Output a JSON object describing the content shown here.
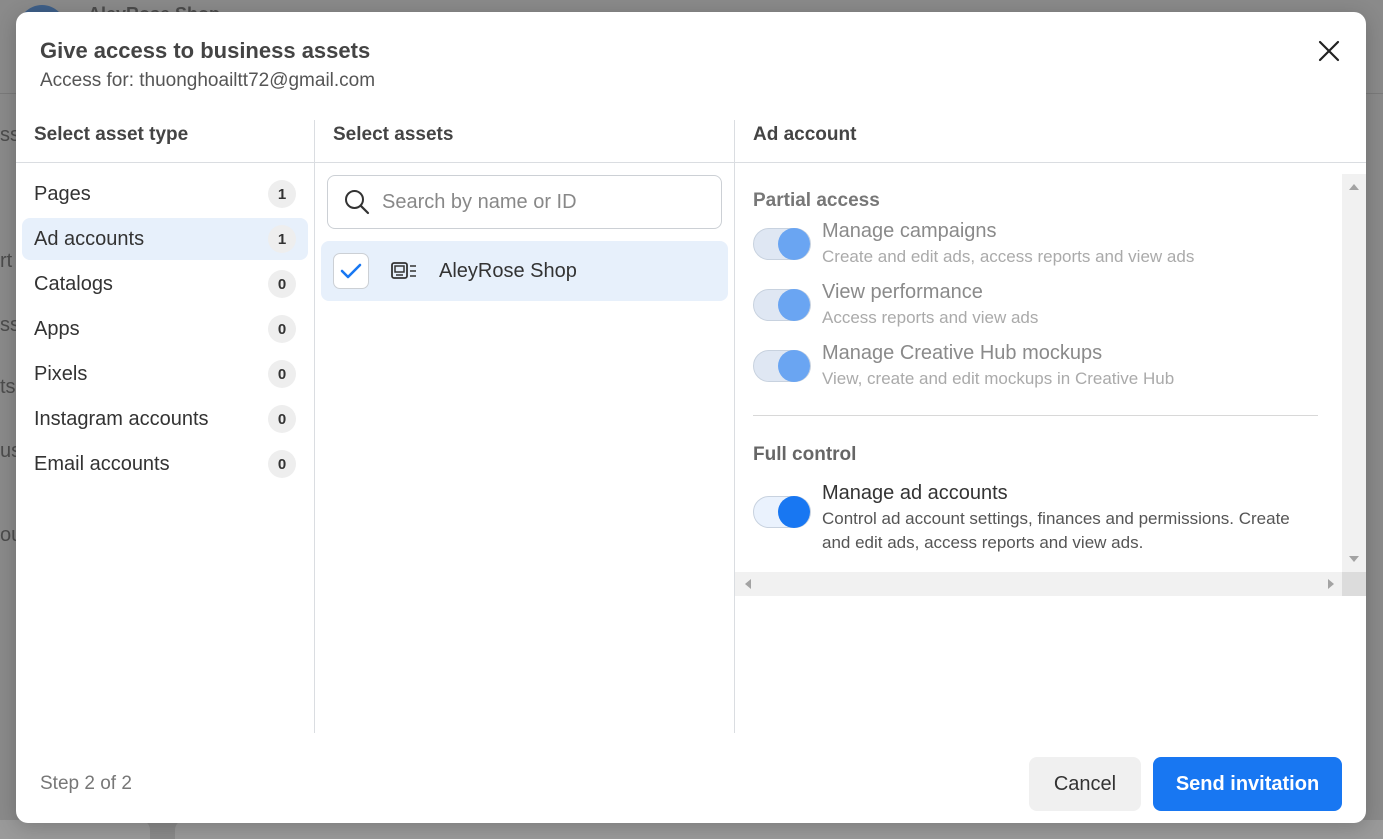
{
  "background": {
    "title_fragment": "AleyRose Shop",
    "left_fragments": [
      "ss",
      "rt",
      "ss",
      "ts",
      "us",
      "ou"
    ]
  },
  "dialog": {
    "title": "Give access to business assets",
    "subtitle": "Access for: thuonghoailtt72@gmail.com",
    "close_icon": "close-icon"
  },
  "asset_types": {
    "heading": "Select asset type",
    "items": [
      {
        "label": "Pages",
        "count": "1",
        "active": false
      },
      {
        "label": "Ad accounts",
        "count": "1",
        "active": true
      },
      {
        "label": "Catalogs",
        "count": "0",
        "active": false
      },
      {
        "label": "Apps",
        "count": "0",
        "active": false
      },
      {
        "label": "Pixels",
        "count": "0",
        "active": false
      },
      {
        "label": "Instagram accounts",
        "count": "0",
        "active": false
      },
      {
        "label": "Email accounts",
        "count": "0",
        "active": false
      }
    ]
  },
  "assets": {
    "heading": "Select assets",
    "search_placeholder": "Search by name or ID",
    "search_value": "",
    "items": [
      {
        "name": "AleyRose Shop",
        "checked": true,
        "icon": "ad-account-icon"
      }
    ]
  },
  "permissions": {
    "heading": "Ad account",
    "partial": {
      "title": "Partial access",
      "items": [
        {
          "name": "Manage campaigns",
          "desc": "Create and edit ads, access reports and view ads",
          "on": true
        },
        {
          "name": "View performance",
          "desc": "Access reports and view ads",
          "on": true
        },
        {
          "name": "Manage Creative Hub mockups",
          "desc": "View, create and edit mockups in Creative Hub",
          "on": true
        }
      ]
    },
    "full": {
      "title": "Full control",
      "items": [
        {
          "name": "Manage ad accounts",
          "desc": "Control ad account settings, finances and permissions. Create and edit ads, access reports and view ads.",
          "on": true
        }
      ]
    }
  },
  "footer": {
    "step": "Step 2 of 2",
    "cancel": "Cancel",
    "send": "Send invitation"
  },
  "colors": {
    "primary": "#1877f2",
    "selected_bg": "#e7f0fb"
  }
}
